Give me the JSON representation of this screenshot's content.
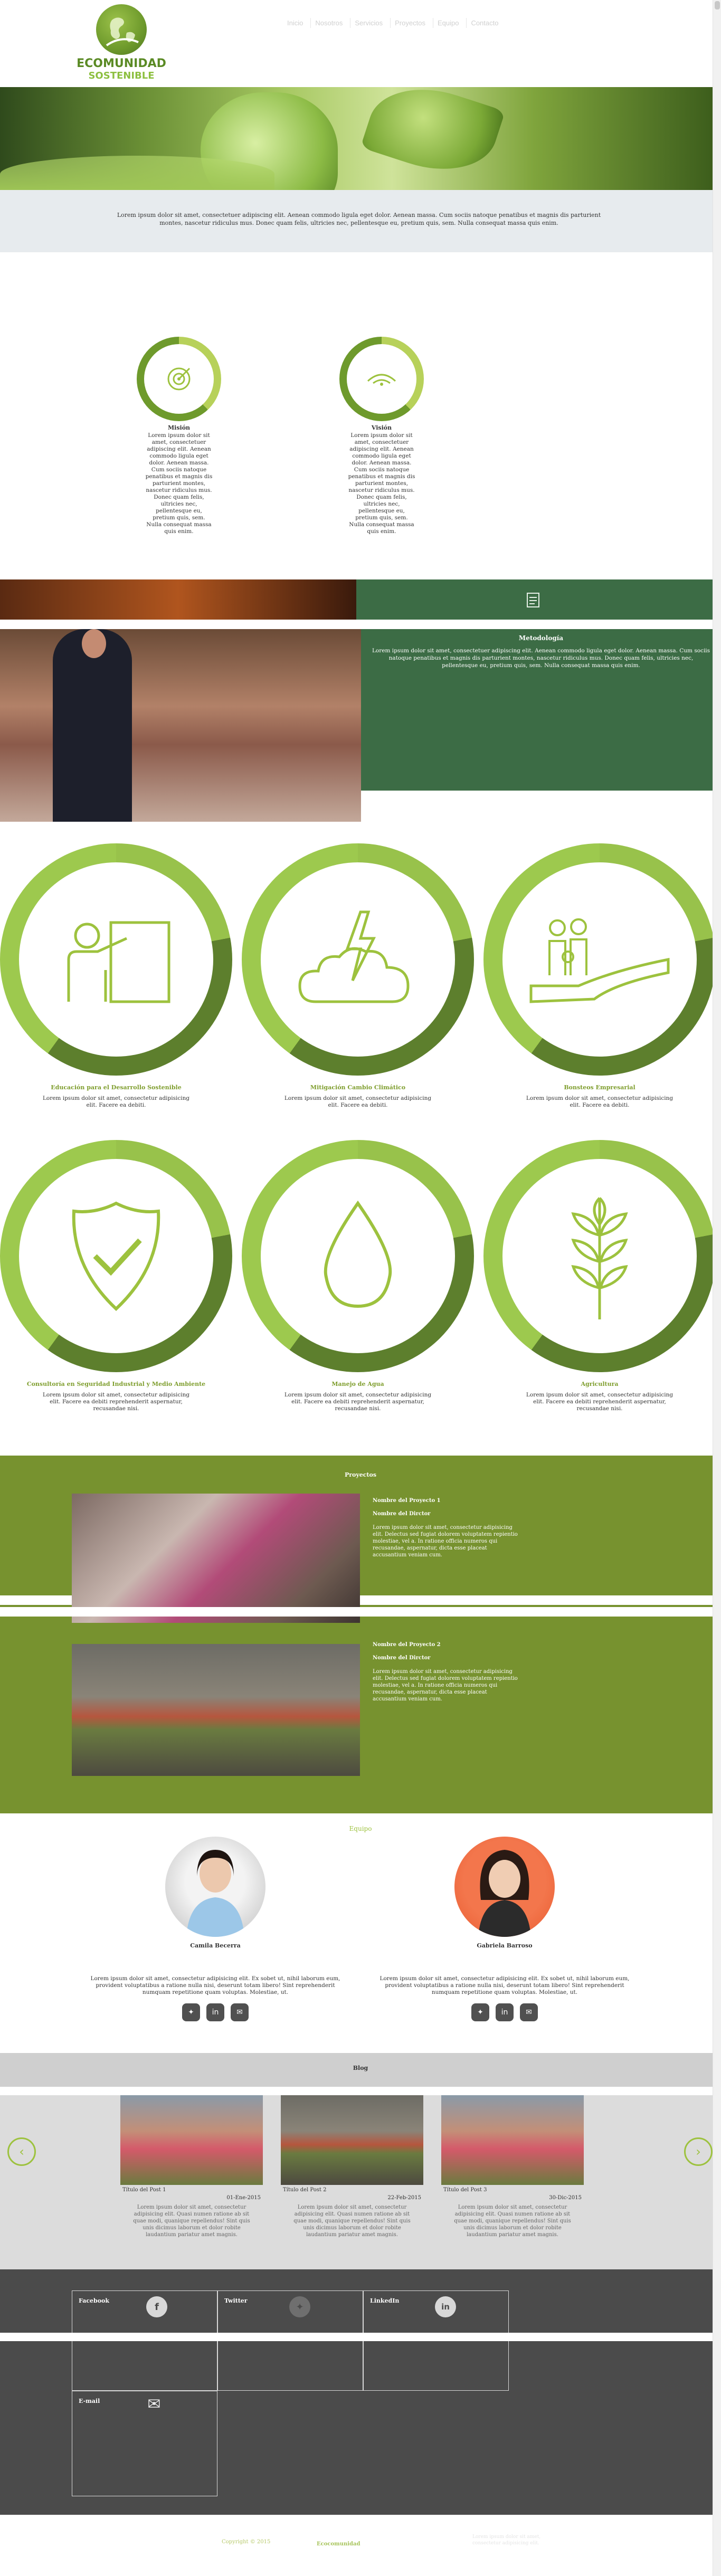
{
  "header": {
    "logo_line1": "ECOMUNIDAD",
    "logo_line2": "SOSTENIBLE",
    "nav": [
      "Inicio",
      "Nosotros",
      "Servicios",
      "Proyectos",
      "Equipo",
      "Contacto"
    ]
  },
  "intro": {
    "text": "Lorem ipsum dolor sit amet, consectetuer adipiscing elit. Aenean commodo ligula eget dolor. Aenean massa. Cum sociis natoque penatibus et magnis dis parturient montes, nascetur ridiculus mus. Donec quam felis, ultricies nec, pellentesque eu, pretium quis, sem. Nulla consequat massa quis enim."
  },
  "mission": {
    "title": "Misión",
    "text": "Lorem ipsum dolor sit amet, consectetuer adipiscing elit. Aenean commodo ligula eget dolor. Aenean massa. Cum sociis natoque penatibus et magnis dis parturient montes, nascetur ridiculus mus. Donec quam felis, ultricies nec, pellentesque eu, pretium quis, sem. Nulla consequat massa quis enim."
  },
  "vision": {
    "title": "Visión",
    "text": "Lorem ipsum dolor sit amet, consectetuer adipiscing elit. Aenean commodo ligula eget dolor. Aenean massa. Cum sociis natoque penatibus et magnis dis parturient montes, nascetur ridiculus mus. Donec quam felis, ultricies nec, pellentesque eu, pretium quis, sem. Nulla consequat massa quis enim."
  },
  "methodology": {
    "title": "Metodología",
    "text": "Lorem ipsum dolor sit amet, consectetuer adipiscing elit. Aenean commodo ligula eget dolor. Aenean massa. Cum sociis natoque penatibus et magnis dis parturient montes, nascetur ridiculus mus. Donec quam felis, ultricies nec, pellentesque eu, pretium quis, sem. Nulla consequat massa quis enim."
  },
  "services": [
    {
      "title": "Educación para el Desarrollo Sostenible",
      "text": "Lorem ipsum dolor sit amet, consectetur adipisicing elit. Facere ea debiti.",
      "icon": "presentation-icon"
    },
    {
      "title": "Mitigación Cambio Climático",
      "text": "Lorem ipsum dolor sit amet, consectetur adipisicing elit. Facere ea debiti.",
      "icon": "storm-cloud-icon"
    },
    {
      "title": "Bonsteos Empresarial",
      "text": "Lorem ipsum dolor sit amet, consectetur adipisicing elit. Facere ea debiti.",
      "icon": "hand-family-icon"
    },
    {
      "title": "Consultoría en Seguridad Industrial y Medio Ambiente",
      "text": "Lorem ipsum dolor sit amet, consectetur adipisicing elit. Facere ea debiti reprehenderit aspernatur, recusandae nisi.",
      "icon": "shield-check-icon"
    },
    {
      "title": "Manejo de Agua",
      "text": "Lorem ipsum dolor sit amet, consectetur adipisicing elit. Facere ea debiti reprehenderit aspernatur, recusandae nisi.",
      "icon": "water-drop-icon"
    },
    {
      "title": "Agricultura",
      "text": "Lorem ipsum dolor sit amet, consectetur adipisicing elit. Facere ea debiti reprehenderit aspernatur, recusandae nisi.",
      "icon": "wheat-icon"
    }
  ],
  "projects": {
    "title": "Proyectos",
    "items": [
      {
        "name": "Nombre del Proyecto 1",
        "owner": "Nombre del Dirctor",
        "text": "Lorem ipsum dolor sit amet, consectetur adipisicing elit. Delectus sed fugiat dolorem voluptatem repientio molestiae, vel a. In ratione officia numeros qui recusandae, aspernatur, dicta esse placeat accusantium veniam cum."
      },
      {
        "name": "Nombre del Proyecto 2",
        "owner": "Nombre del Dirctor",
        "text": "Lorem ipsum dolor sit amet, consectetur adipisicing elit. Delectus sed fugiat dolorem voluptatem repientio molestiae, vel a. In ratione officia numeros qui recusandae, aspernatur, dicta esse placeat accusantium veniam cum."
      }
    ]
  },
  "team": {
    "title": "Equipo",
    "members": [
      {
        "name": "Camila Becerra",
        "text": "Lorem ipsum dolor sit amet, consectetur adipisicing elit. Ex sobet ut, nihil laborum eum, provident voluptatibus a ratione nulla nisi, deserunt totam libero! Sint reprehenderit numquam repetitione quam voluptas. Molestiae, ut."
      },
      {
        "name": "Gabriela Barroso",
        "text": "Lorem ipsum dolor sit amet, consectetur adipisicing elit. Ex sobet ut, nihil laborum eum, provident voluptatibus a ratione nulla nisi, deserunt totam libero! Sint reprehenderit numquam repetitione quam voluptas. Molestiae, ut."
      }
    ]
  },
  "blog": {
    "title": "Blog",
    "posts": [
      {
        "title": "Título del Post 1",
        "date": "01-Ene-2015",
        "text": "Lorem ipsum dolor sit amet, consectetur adipisicing elit. Quasi numen ratione ab sit quae modi, quanique repellendus! Sint quis unis dicimus laborum et dolor robite laudantium pariatur amet magnis."
      },
      {
        "title": "Título del Post 2",
        "date": "22-Feb-2015",
        "text": "Lorem ipsum dolor sit amet, consectetur adipisicing elit. Quasi numen ratione ab sit quae modi, quanique repellendus! Sint quis unis dicimus laborum et dolor robite laudantium pariatur amet magnis."
      },
      {
        "title": "Título del Post 3",
        "date": "30-Dic-2015",
        "text": "Lorem ipsum dolor sit amet, consectetur adipisicing elit. Quasi numen ratione ab sit quae modi, quanique repellendus! Sint quis unis dicimus laborum et dolor robite laudantium pariatur amet magnis."
      }
    ]
  },
  "contact": {
    "facebook": "Facebook",
    "twitter": "Twitter",
    "linkedin": "LinkedIn",
    "email": "E-mail"
  },
  "footer": {
    "copyright": "Copyright © 2015",
    "brand": "Ecocomunidad",
    "right_text": "Lorem ipsum dolor sit amet, consectetur adipisicing elit."
  },
  "colors": {
    "accent": "#9dc23e",
    "dark_green": "#3c6c45",
    "olive": "#77922f",
    "contact_bg": "#4b4b4b"
  }
}
